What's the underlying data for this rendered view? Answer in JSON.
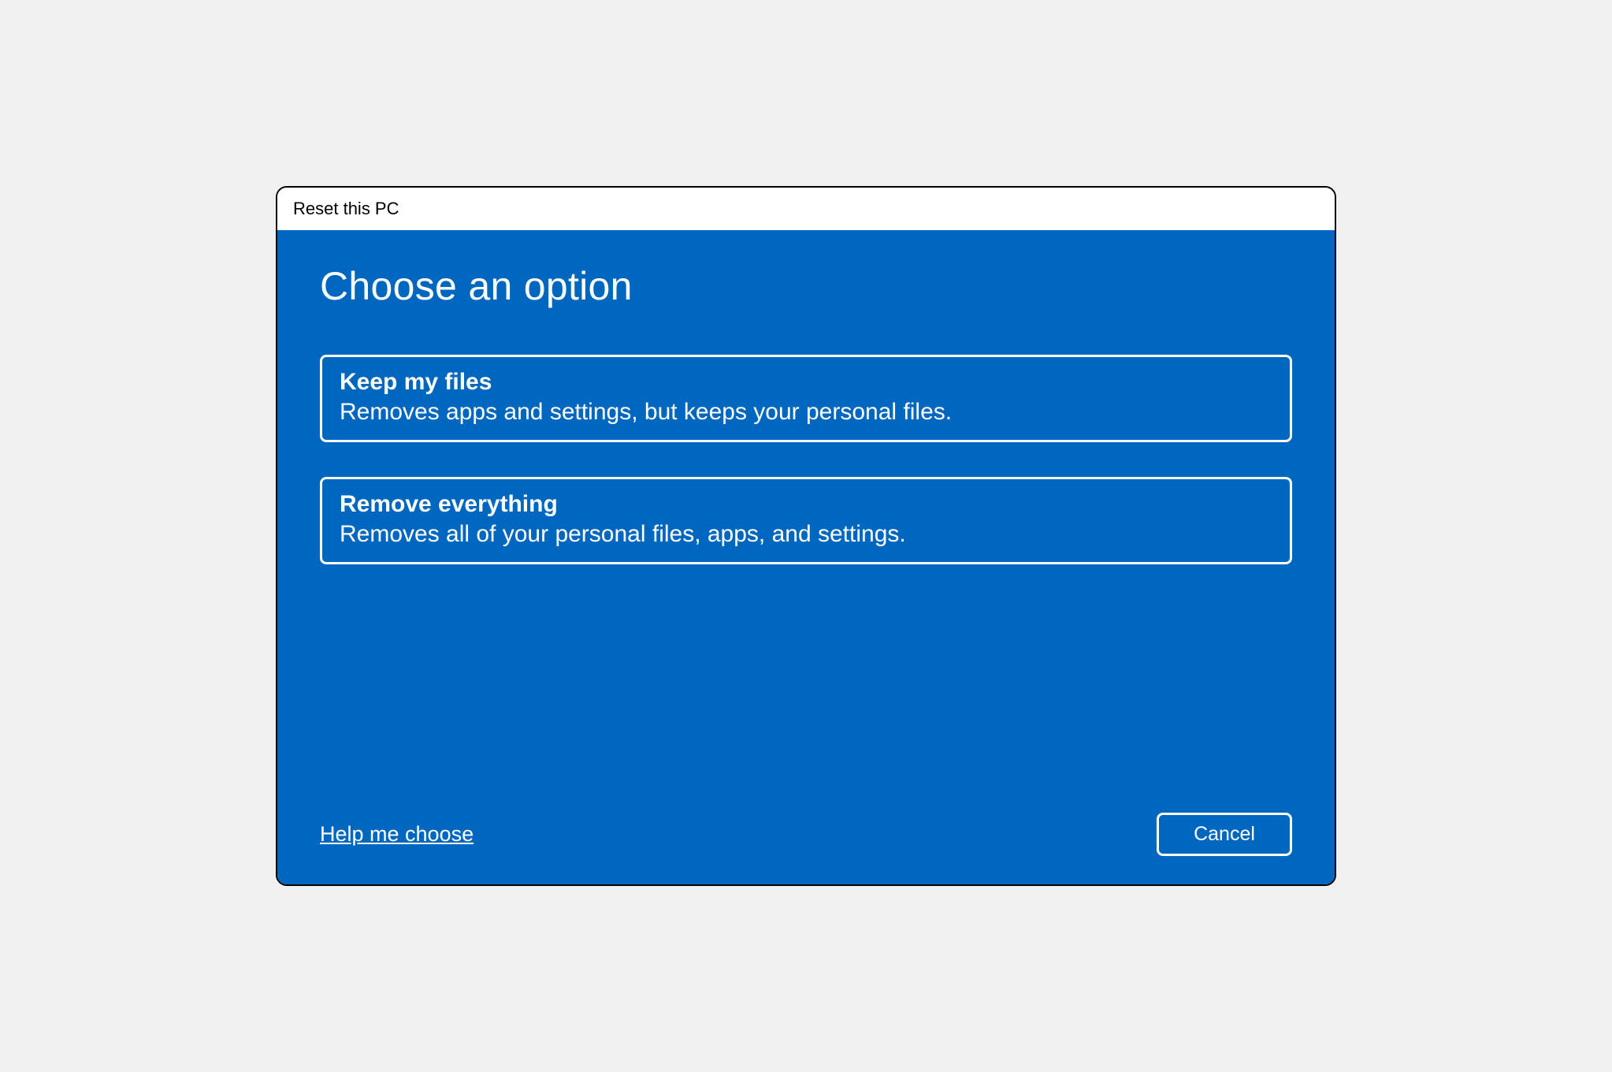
{
  "window": {
    "title": "Reset this PC"
  },
  "main": {
    "heading": "Choose an option",
    "options": [
      {
        "title": "Keep my files",
        "description": "Removes apps and settings, but keeps your personal files."
      },
      {
        "title": "Remove everything",
        "description": "Removes all of your personal files, apps, and settings."
      }
    ]
  },
  "footer": {
    "help_link": "Help me choose",
    "cancel_label": "Cancel"
  },
  "colors": {
    "accent": "#0067c0",
    "text_on_accent": "#ffffff"
  }
}
